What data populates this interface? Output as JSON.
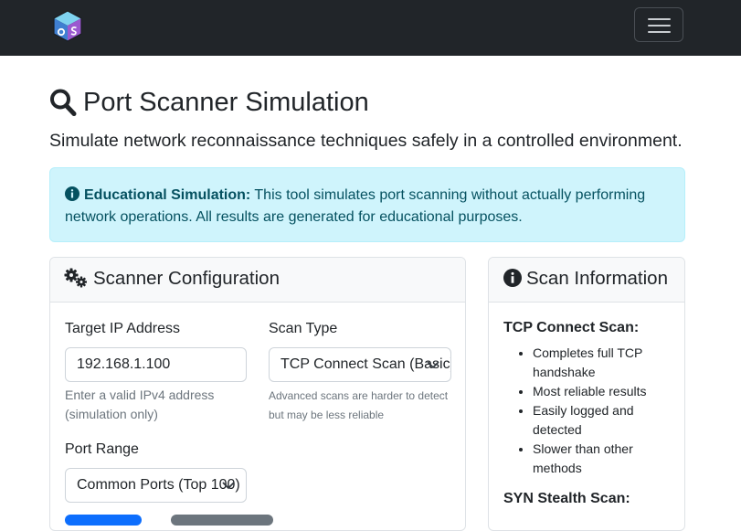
{
  "navbar": {
    "logo_icon": "os-cube-logo-icon",
    "menu_icon": "hamburger-menu-icon"
  },
  "page": {
    "title": "Port Scanner Simulation",
    "title_icon": "magnifying-glass-icon",
    "lead": "Simulate network reconnaissance techniques safely in a controlled environment."
  },
  "alert": {
    "icon": "info-circle-icon",
    "strong": "Educational Simulation:",
    "text": " This tool simulates port scanning without actually performing network operations. All results are generated for educational purposes."
  },
  "config": {
    "header_icon": "gears-icon",
    "header": "Scanner Configuration",
    "target_ip": {
      "label": "Target IP Address",
      "value": "192.168.1.100",
      "help": "Enter a valid IPv4 address (simulation only)"
    },
    "scan_type": {
      "label": "Scan Type",
      "value": "TCP Connect Scan (Basic)",
      "help": "Advanced scans are harder to detect but may be less reliable"
    },
    "port_range": {
      "label": "Port Range",
      "value": "Common Ports (Top 100)"
    }
  },
  "info": {
    "header_icon": "info-circle-icon",
    "header": "Scan Information",
    "sections": [
      {
        "title": "TCP Connect Scan:",
        "items": [
          "Completes full TCP handshake",
          "Most reliable results",
          "Easily logged and detected",
          "Slower than other methods"
        ]
      },
      {
        "title": "SYN Stealth Scan:"
      }
    ]
  },
  "colors": {
    "navbar_bg": "#212529",
    "alert_bg": "#cff4fc",
    "alert_text": "#055160",
    "primary": "#0d6efd",
    "secondary": "#6c757d"
  }
}
